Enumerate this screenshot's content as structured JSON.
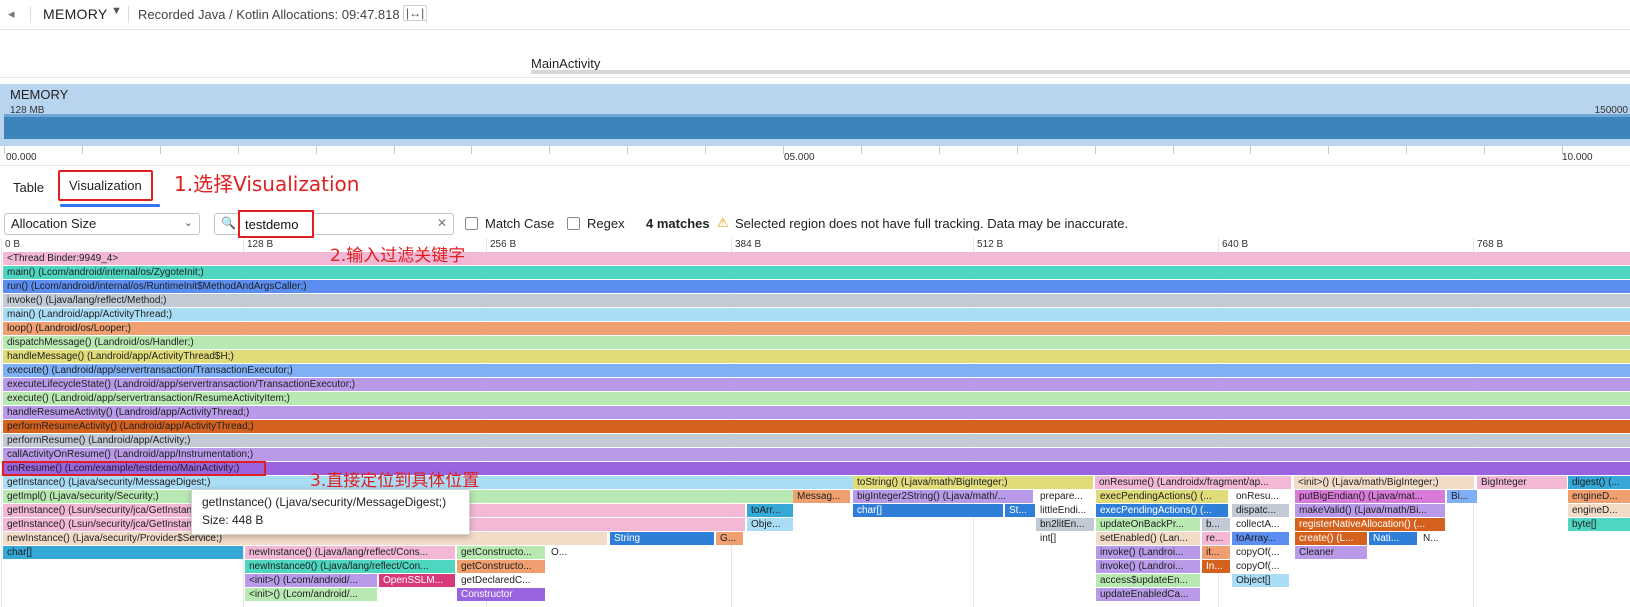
{
  "topbar": {
    "back_icon": "back-arrow-icon",
    "title": "MEMORY",
    "recorded": "Recorded Java / Kotlin Allocations: 09:47.818",
    "fit_icon": "fit-width-icon"
  },
  "activity": {
    "label": "MainActivity"
  },
  "memory_track": {
    "label": "MEMORY",
    "scale_left": "128 MB",
    "scale_right": "150000"
  },
  "time_ruler": [
    "00.000",
    "05.000",
    "10.000"
  ],
  "tabs": [
    {
      "label": "Table",
      "active": false
    },
    {
      "label": "Visualization",
      "active": true
    }
  ],
  "annotations": {
    "step1": "1.选择Visualization",
    "step2": "2.输入过滤关键字",
    "step3": "3.直接定位到具体位置"
  },
  "filter": {
    "mode": "Allocation Size",
    "search_value": "testdemo",
    "match_case": "Match Case",
    "regex": "Regex",
    "matches": "4 matches",
    "warning": "Selected region does not have full tracking. Data may be inaccurate."
  },
  "flame_axis": [
    "0 B",
    "128 B",
    "256 B",
    "384 B",
    "512 B",
    "640 B",
    "768 B"
  ],
  "tooltip": {
    "method": "getInstance() (Ljava/security/MessageDigest;)",
    "size": "Size: 448 B"
  },
  "stack": [
    {
      "label": "<Thread Binder:9949_4>",
      "color": "#f2b8d6"
    },
    {
      "label": "main() (Lcom/android/internal/os/ZygoteInit;)",
      "color": "#4fd6c0"
    },
    {
      "label": "run() (Lcom/android/internal/os/RuntimeInit$MethodAndArgsCaller;)",
      "color": "#5b8ef0"
    },
    {
      "label": "invoke() (Ljava/lang/reflect/Method;)",
      "color": "#c2cad6"
    },
    {
      "label": "main() (Landroid/app/ActivityThread;)",
      "color": "#a9dcf5"
    },
    {
      "label": "loop() (Landroid/os/Looper;)",
      "color": "#f0a070"
    },
    {
      "label": "dispatchMessage() (Landroid/os/Handler;)",
      "color": "#b9e9b2"
    },
    {
      "label": "handleMessage() (Landroid/app/ActivityThread$H;)",
      "color": "#e0dc7a"
    },
    {
      "label": "execute() (Landroid/app/servertransaction/TransactionExecutor;)",
      "color": "#7fb0f5"
    },
    {
      "label": "executeLifecycleState() (Landroid/app/servertransaction/TransactionExecutor;)",
      "color": "#b99ae8"
    },
    {
      "label": "execute() (Landroid/app/servertransaction/ResumeActivityItem;)",
      "color": "#b9e9b2"
    },
    {
      "label": "handleResumeActivity() (Landroid/app/ActivityThread;)",
      "color": "#b99ae8"
    },
    {
      "label": "performResumeActivity() (Landroid/app/ActivityThread;)",
      "color": "#d4621e"
    },
    {
      "label": "performResume() (Landroid/app/Activity;)",
      "color": "#c2cad6"
    },
    {
      "label": "callActivityOnResume() (Landroid/app/Instrumentation;)",
      "color": "#b99ae8"
    },
    {
      "label": "onResume() (Lcom/example/testdemo/MainActivity;)",
      "color": "#9a64e0"
    }
  ],
  "frames": [
    {
      "label": "getInstance() (Ljava/security/MessageDigest;)",
      "color": "#a9dcf5"
    },
    {
      "label": "toString() (Ljava/math/BigInteger;)",
      "color": "#e0dc7a"
    },
    {
      "label": "onResume() (Landroidx/fragment/ap...",
      "color": "#f2b8d6"
    },
    {
      "label": "<init>() (Ljava/math/BigInteger;)",
      "color": "#f2dcc8"
    },
    {
      "label": "BigInteger",
      "color": "#f2b8d6"
    },
    {
      "label": "digest() (...",
      "color": "#36a8d8"
    },
    {
      "label": "getImpl() (Ljava/security/Security;)",
      "color": "#b9e9b2"
    },
    {
      "label": "Messag...",
      "color": "#f0a070"
    },
    {
      "label": "bigInteger2String() (Ljava/math/...",
      "color": "#b99ae8"
    },
    {
      "label": "prepare...",
      "color": "#ffffff"
    },
    {
      "label": "execPendingActions() (...",
      "color": "#e0dc7a"
    },
    {
      "label": "onResu...",
      "color": "#ffffff"
    },
    {
      "label": "putBigEndian() (Ljava/mat...",
      "color": "#d87ad8"
    },
    {
      "label": "Bi...",
      "color": "#7fb0f5"
    },
    {
      "label": "engineD...",
      "color": "#f0a070"
    },
    {
      "label": "getInstance() (Lsun/security/jca/GetInstance;)",
      "color": "#f2b8d6"
    },
    {
      "label": "toArr...",
      "color": "#36a8d8"
    },
    {
      "label": "char[]",
      "color": "#2f7fd8"
    },
    {
      "label": "St...",
      "color": "#2f7fd8"
    },
    {
      "label": "littleEndi...",
      "color": "#ffffff"
    },
    {
      "label": "execPendingActions() (...",
      "color": "#2f7fd8"
    },
    {
      "label": "dispatc...",
      "color": "#c2cad6"
    },
    {
      "label": "makeValid() (Ljava/math/Bi...",
      "color": "#b99ae8"
    },
    {
      "label": "engineD...",
      "color": "#f2dcc8"
    },
    {
      "label": "getInstance() (Lsun/security/jca/GetInstance;)",
      "color": "#f2b8d6"
    },
    {
      "label": "Obje...",
      "color": "#a9dcf5"
    },
    {
      "label": "bn2litEn...",
      "color": "#c2cad6"
    },
    {
      "label": "updateOnBackPr...",
      "color": "#b9e9b2"
    },
    {
      "label": "b...",
      "color": "#c2cad6"
    },
    {
      "label": "collectA...",
      "color": "#ffffff"
    },
    {
      "label": "registerNativeAllocation() (...",
      "color": "#d4621e"
    },
    {
      "label": "byte[]",
      "color": "#4fd6c0"
    },
    {
      "label": "newInstance() (Ljava/security/Provider$Service;)",
      "color": "#f2dcc8"
    },
    {
      "label": "String",
      "color": "#2f7fd8"
    },
    {
      "label": "G...",
      "color": "#f0a070"
    },
    {
      "label": "int[]",
      "color": "#ffffff"
    },
    {
      "label": "setEnabled() (Lan...",
      "color": "#f2dcc8"
    },
    {
      "label": "re...",
      "color": "#f2b8d6"
    },
    {
      "label": "toArray...",
      "color": "#5b8ef0"
    },
    {
      "label": "create() (L...",
      "color": "#d4621e"
    },
    {
      "label": "Nati...",
      "color": "#2f7fd8"
    },
    {
      "label": "N...",
      "color": "#ffffff"
    },
    {
      "label": "char[]",
      "color": "#36a8d8"
    },
    {
      "label": "newInstance() (Ljava/lang/reflect/Cons...",
      "color": "#f2b8d6"
    },
    {
      "label": "getConstructo...",
      "color": "#b9e9b2"
    },
    {
      "label": "O...",
      "color": "#ffffff"
    },
    {
      "label": "invoke() (Landroi...",
      "color": "#b99ae8"
    },
    {
      "label": "it...",
      "color": "#f0a070"
    },
    {
      "label": "copyOf(...",
      "color": "#ffffff"
    },
    {
      "label": "Cleaner",
      "color": "#b99ae8"
    },
    {
      "label": "newInstance0() (Ljava/lang/reflect/Con...",
      "color": "#4fd6c0"
    },
    {
      "label": "getConstructo...",
      "color": "#f0a070"
    },
    {
      "label": "invoke() (Landroi...",
      "color": "#b99ae8"
    },
    {
      "label": "In...",
      "color": "#d4621e"
    },
    {
      "label": "copyOf(...",
      "color": "#ffffff"
    },
    {
      "label": "<init>() (Lcom/android/...",
      "color": "#b99ae8"
    },
    {
      "label": "OpenSSLM...",
      "color": "#d8397a"
    },
    {
      "label": "getDeclaredC...",
      "color": "#ffffff"
    },
    {
      "label": "access$updateEn...",
      "color": "#b9e9b2"
    },
    {
      "label": "Object[]",
      "color": "#a9dcf5"
    },
    {
      "label": "<init>() (Lcom/android/...",
      "color": "#b9e9b2"
    },
    {
      "label": "Constructor",
      "color": "#9a64e0"
    },
    {
      "label": "updateEnabledCa...",
      "color": "#b99ae8"
    }
  ]
}
